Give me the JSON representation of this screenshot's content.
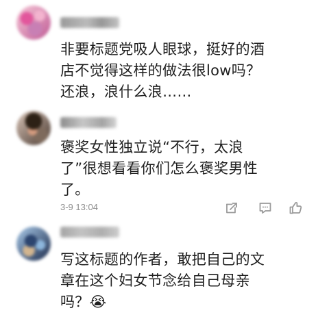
{
  "comments": [
    {
      "text_lines": [
        "非要标题党吸人眼球，挺好的酒",
        "店不觉得这样的做法很low吗？",
        "还浪，浪什么浪……"
      ]
    },
    {
      "text_lines": [
        "褒奖女性独立说“不行，太浪",
        "了”很想看看你们怎么褒奖男性",
        "了。"
      ],
      "timestamp": "3-9 13:04"
    },
    {
      "text_lines": [
        "写这标题的作者，敢把自己的文",
        "章在这个妇女节念给自己母亲",
        "吗？😭"
      ]
    }
  ],
  "icons": {
    "forward": "share-icon",
    "reply": "comment-icon",
    "like": "thumbs-up-icon"
  },
  "colors": {
    "text_primary": "#1f1f1f",
    "text_secondary": "#8d8d8d",
    "icon_gray": "#9a9a9a",
    "background": "#ffffff"
  }
}
